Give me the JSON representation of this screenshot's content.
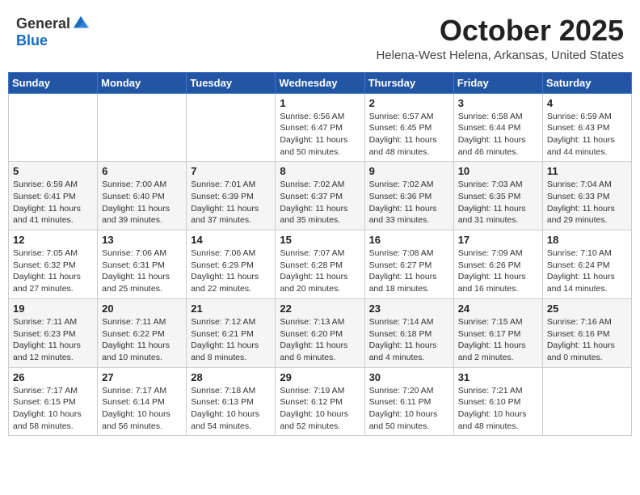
{
  "logo": {
    "general": "General",
    "blue": "Blue"
  },
  "title": {
    "month": "October 2025",
    "location": "Helena-West Helena, Arkansas, United States"
  },
  "days_of_week": [
    "Sunday",
    "Monday",
    "Tuesday",
    "Wednesday",
    "Thursday",
    "Friday",
    "Saturday"
  ],
  "weeks": [
    [
      {
        "day": "",
        "info": ""
      },
      {
        "day": "",
        "info": ""
      },
      {
        "day": "",
        "info": ""
      },
      {
        "day": "1",
        "info": "Sunrise: 6:56 AM\nSunset: 6:47 PM\nDaylight: 11 hours and 50 minutes."
      },
      {
        "day": "2",
        "info": "Sunrise: 6:57 AM\nSunset: 6:45 PM\nDaylight: 11 hours and 48 minutes."
      },
      {
        "day": "3",
        "info": "Sunrise: 6:58 AM\nSunset: 6:44 PM\nDaylight: 11 hours and 46 minutes."
      },
      {
        "day": "4",
        "info": "Sunrise: 6:59 AM\nSunset: 6:43 PM\nDaylight: 11 hours and 44 minutes."
      }
    ],
    [
      {
        "day": "5",
        "info": "Sunrise: 6:59 AM\nSunset: 6:41 PM\nDaylight: 11 hours and 41 minutes."
      },
      {
        "day": "6",
        "info": "Sunrise: 7:00 AM\nSunset: 6:40 PM\nDaylight: 11 hours and 39 minutes."
      },
      {
        "day": "7",
        "info": "Sunrise: 7:01 AM\nSunset: 6:39 PM\nDaylight: 11 hours and 37 minutes."
      },
      {
        "day": "8",
        "info": "Sunrise: 7:02 AM\nSunset: 6:37 PM\nDaylight: 11 hours and 35 minutes."
      },
      {
        "day": "9",
        "info": "Sunrise: 7:02 AM\nSunset: 6:36 PM\nDaylight: 11 hours and 33 minutes."
      },
      {
        "day": "10",
        "info": "Sunrise: 7:03 AM\nSunset: 6:35 PM\nDaylight: 11 hours and 31 minutes."
      },
      {
        "day": "11",
        "info": "Sunrise: 7:04 AM\nSunset: 6:33 PM\nDaylight: 11 hours and 29 minutes."
      }
    ],
    [
      {
        "day": "12",
        "info": "Sunrise: 7:05 AM\nSunset: 6:32 PM\nDaylight: 11 hours and 27 minutes."
      },
      {
        "day": "13",
        "info": "Sunrise: 7:06 AM\nSunset: 6:31 PM\nDaylight: 11 hours and 25 minutes."
      },
      {
        "day": "14",
        "info": "Sunrise: 7:06 AM\nSunset: 6:29 PM\nDaylight: 11 hours and 22 minutes."
      },
      {
        "day": "15",
        "info": "Sunrise: 7:07 AM\nSunset: 6:28 PM\nDaylight: 11 hours and 20 minutes."
      },
      {
        "day": "16",
        "info": "Sunrise: 7:08 AM\nSunset: 6:27 PM\nDaylight: 11 hours and 18 minutes."
      },
      {
        "day": "17",
        "info": "Sunrise: 7:09 AM\nSunset: 6:26 PM\nDaylight: 11 hours and 16 minutes."
      },
      {
        "day": "18",
        "info": "Sunrise: 7:10 AM\nSunset: 6:24 PM\nDaylight: 11 hours and 14 minutes."
      }
    ],
    [
      {
        "day": "19",
        "info": "Sunrise: 7:11 AM\nSunset: 6:23 PM\nDaylight: 11 hours and 12 minutes."
      },
      {
        "day": "20",
        "info": "Sunrise: 7:11 AM\nSunset: 6:22 PM\nDaylight: 11 hours and 10 minutes."
      },
      {
        "day": "21",
        "info": "Sunrise: 7:12 AM\nSunset: 6:21 PM\nDaylight: 11 hours and 8 minutes."
      },
      {
        "day": "22",
        "info": "Sunrise: 7:13 AM\nSunset: 6:20 PM\nDaylight: 11 hours and 6 minutes."
      },
      {
        "day": "23",
        "info": "Sunrise: 7:14 AM\nSunset: 6:18 PM\nDaylight: 11 hours and 4 minutes."
      },
      {
        "day": "24",
        "info": "Sunrise: 7:15 AM\nSunset: 6:17 PM\nDaylight: 11 hours and 2 minutes."
      },
      {
        "day": "25",
        "info": "Sunrise: 7:16 AM\nSunset: 6:16 PM\nDaylight: 11 hours and 0 minutes."
      }
    ],
    [
      {
        "day": "26",
        "info": "Sunrise: 7:17 AM\nSunset: 6:15 PM\nDaylight: 10 hours and 58 minutes."
      },
      {
        "day": "27",
        "info": "Sunrise: 7:17 AM\nSunset: 6:14 PM\nDaylight: 10 hours and 56 minutes."
      },
      {
        "day": "28",
        "info": "Sunrise: 7:18 AM\nSunset: 6:13 PM\nDaylight: 10 hours and 54 minutes."
      },
      {
        "day": "29",
        "info": "Sunrise: 7:19 AM\nSunset: 6:12 PM\nDaylight: 10 hours and 52 minutes."
      },
      {
        "day": "30",
        "info": "Sunrise: 7:20 AM\nSunset: 6:11 PM\nDaylight: 10 hours and 50 minutes."
      },
      {
        "day": "31",
        "info": "Sunrise: 7:21 AM\nSunset: 6:10 PM\nDaylight: 10 hours and 48 minutes."
      },
      {
        "day": "",
        "info": ""
      }
    ]
  ]
}
